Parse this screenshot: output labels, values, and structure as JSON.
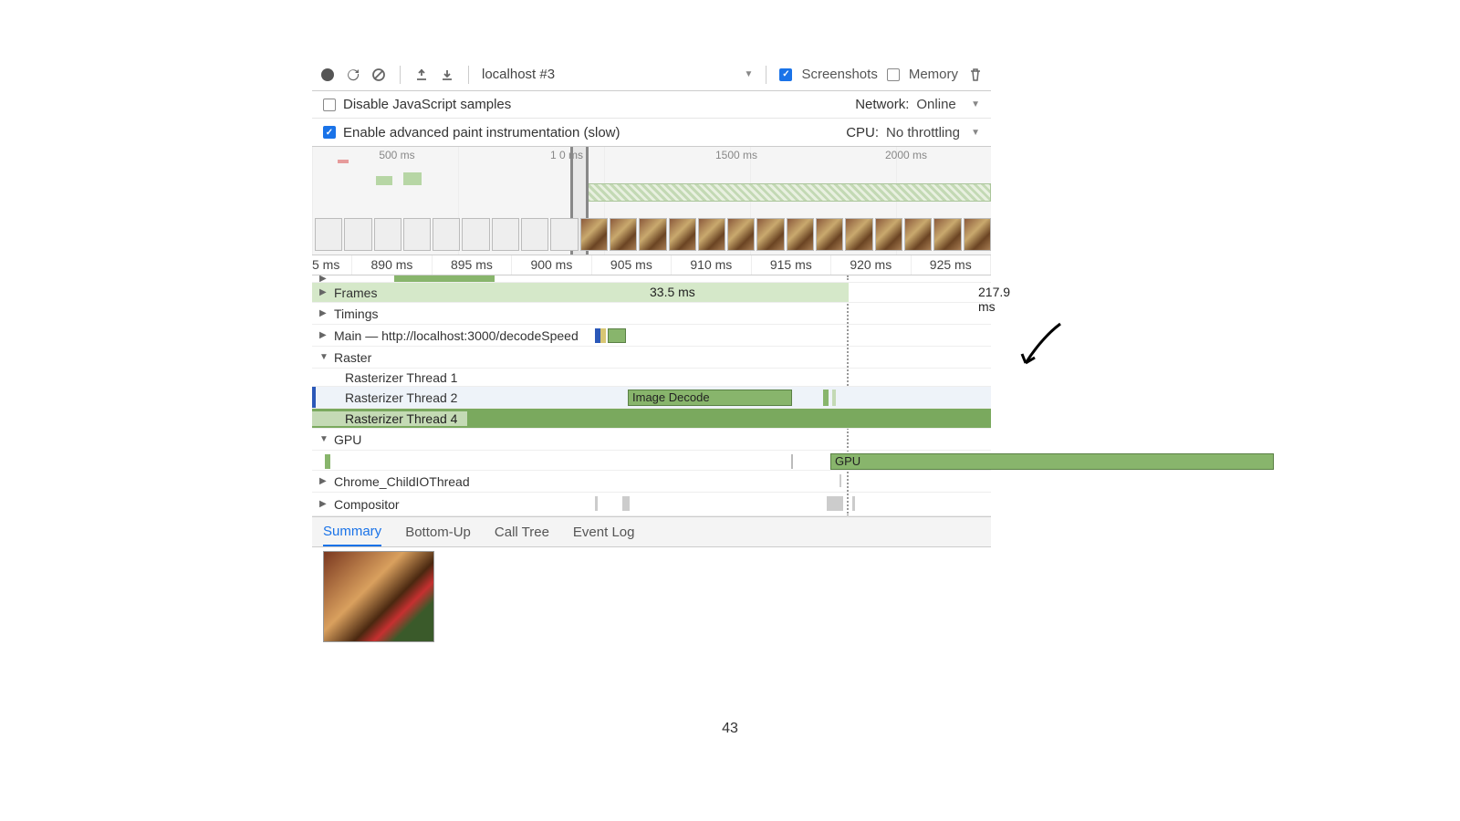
{
  "pageNumber": "43",
  "toolbar": {
    "recording_target": "localhost #3",
    "screenshots_label": "Screenshots",
    "memory_label": "Memory"
  },
  "settings": {
    "disable_js_label": "Disable JavaScript samples",
    "enable_paint_label": "Enable advanced paint instrumentation (slow)",
    "network_label": "Network:",
    "network_value": "Online",
    "cpu_label": "CPU:",
    "cpu_value": "No throttling"
  },
  "overview_ticks": [
    "500 ms",
    "1 0  ms",
    "1500 ms",
    "2000 ms"
  ],
  "detail_ruler": [
    "5 ms",
    "890 ms",
    "895 ms",
    "900 ms",
    "905 ms",
    "910 ms",
    "915 ms",
    "920 ms",
    "925 ms"
  ],
  "tracks": {
    "frames_label": "Frames",
    "frames_time_1": "33.5 ms",
    "frames_time_2": "217.9 ms",
    "timings_label": "Timings",
    "main_label": "Main — http://localhost:3000/decodeSpeed",
    "raster_label": "Raster",
    "raster_t1": "Rasterizer Thread 1",
    "raster_t2": "Rasterizer Thread 2",
    "raster_t4": "Rasterizer Thread 4",
    "image_decode_label": "Image Decode",
    "gpu_label": "GPU",
    "gpu_seg_label": "GPU",
    "child_io_label": "Chrome_ChildIOThread",
    "compositor_label": "Compositor"
  },
  "tabs": {
    "summary": "Summary",
    "bottomup": "Bottom-Up",
    "calltree": "Call Tree",
    "eventlog": "Event Log"
  }
}
